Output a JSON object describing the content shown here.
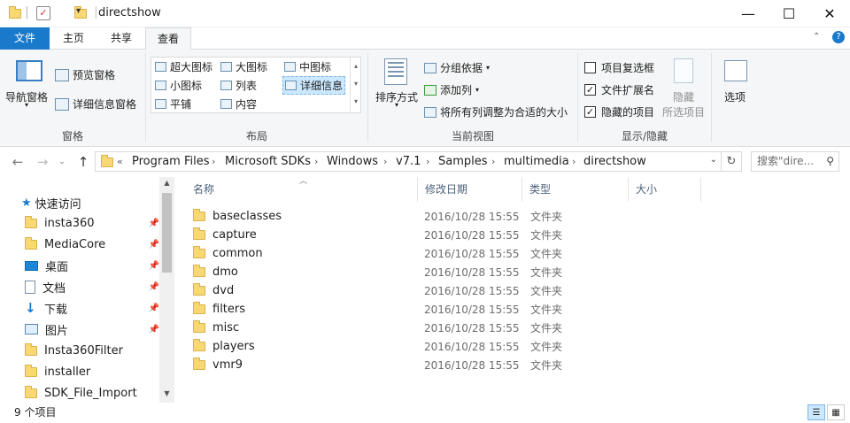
{
  "window": {
    "title": "directshow",
    "minimize": "—",
    "maximize": "☐",
    "close": "✕"
  },
  "ribbon_tabs": [
    {
      "label": "文件"
    },
    {
      "label": "主页"
    },
    {
      "label": "共享"
    },
    {
      "label": "查看"
    }
  ],
  "ribbon": {
    "panes": {
      "label": "窗格",
      "nav_pane": "导航窗格",
      "preview_pane": "预览窗格",
      "details_pane": "详细信息窗格"
    },
    "layout": {
      "label": "布局",
      "items": [
        "超大图标",
        "大图标",
        "中图标",
        "小图标",
        "列表",
        "详细信息",
        "平铺",
        "内容"
      ],
      "selected": "详细信息"
    },
    "current_view": {
      "label": "当前视图",
      "sort": "排序方式",
      "group_by": "分组依据",
      "add_column": "添加列",
      "fit_columns": "将所有列调整为合适的大小"
    },
    "show_hide": {
      "label": "显示/隐藏",
      "item_checkboxes": {
        "label": "项目复选框",
        "checked": false
      },
      "file_extensions": {
        "label": "文件扩展名",
        "checked": true
      },
      "hidden_items": {
        "label": "隐藏的项目",
        "checked": true
      },
      "hide_selected": "隐藏",
      "hide_selected_sub": "所选项目",
      "options": "选项"
    }
  },
  "address": {
    "overflow": "«",
    "crumbs": [
      "Program Files",
      "Microsoft SDKs",
      "Windows",
      "v7.1",
      "Samples",
      "multimedia",
      "directshow"
    ],
    "search_placeholder": "搜索\"dire..."
  },
  "nav_pane": {
    "quick_access": "快速访问",
    "items": [
      {
        "label": "insta360",
        "icon": "folder-icon",
        "pinned": true
      },
      {
        "label": "MediaCore",
        "icon": "folder-icon",
        "pinned": true
      },
      {
        "label": "桌面",
        "icon": "desktop-icon",
        "pinned": true
      },
      {
        "label": "文档",
        "icon": "document-icon",
        "pinned": true
      },
      {
        "label": "下载",
        "icon": "download-icon",
        "pinned": true
      },
      {
        "label": "图片",
        "icon": "picture-icon",
        "pinned": true
      },
      {
        "label": "Insta360Filter",
        "icon": "folder-icon",
        "pinned": false
      },
      {
        "label": "installer",
        "icon": "folder-icon",
        "pinned": false
      },
      {
        "label": "SDK_File_Import",
        "icon": "folder-icon",
        "pinned": false
      }
    ]
  },
  "file_list": {
    "columns": [
      "名称",
      "修改日期",
      "类型",
      "大小"
    ],
    "rows": [
      {
        "name": "baseclasses",
        "date": "2016/10/28 15:55",
        "type": "文件夹"
      },
      {
        "name": "capture",
        "date": "2016/10/28 15:55",
        "type": "文件夹"
      },
      {
        "name": "common",
        "date": "2016/10/28 15:55",
        "type": "文件夹"
      },
      {
        "name": "dmo",
        "date": "2016/10/28 15:55",
        "type": "文件夹"
      },
      {
        "name": "dvd",
        "date": "2016/10/28 15:55",
        "type": "文件夹"
      },
      {
        "name": "filters",
        "date": "2016/10/28 15:55",
        "type": "文件夹"
      },
      {
        "name": "misc",
        "date": "2016/10/28 15:55",
        "type": "文件夹"
      },
      {
        "name": "players",
        "date": "2016/10/28 15:55",
        "type": "文件夹"
      },
      {
        "name": "vmr9",
        "date": "2016/10/28 15:55",
        "type": "文件夹"
      }
    ]
  },
  "status": {
    "count": "9 个项目"
  },
  "colors": {
    "accent": "#1979ca",
    "folder": "#f8d775",
    "ribbon_bg": "#f5f6f7"
  }
}
